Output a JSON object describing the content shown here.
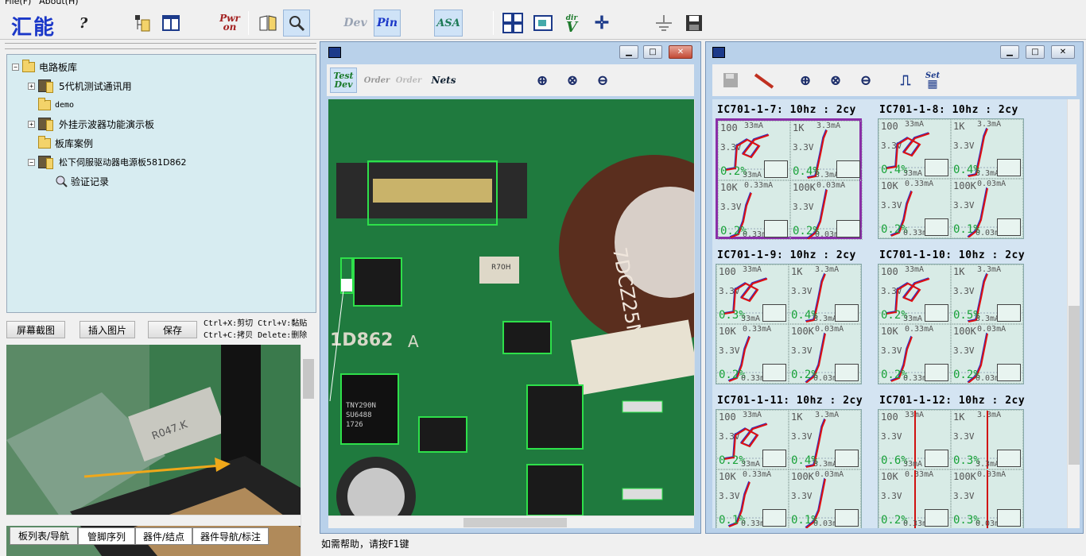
{
  "menu": {
    "items": [
      "File(F)",
      "About(H)"
    ]
  },
  "toolbar": {
    "logo": "汇能",
    "help": "?",
    "pwr_top": "Pwr",
    "pwr_bottom": "on",
    "dev": "Dev",
    "pin": "Pin",
    "asa": "ASA",
    "dirv_top": "dir",
    "dirv_bottom": "V"
  },
  "tree": {
    "root": "电路板库",
    "items": [
      "5代机测试通讯用",
      "demo",
      "外挂示波器功能演示板",
      "板库案例",
      "松下伺服驱动器电源板581D862",
      "验证记录"
    ]
  },
  "left_buttons": {
    "screenshot": "屏幕截图",
    "insert": "插入图片",
    "save": "保存"
  },
  "hints": {
    "line1": "Ctrl+X:剪切 Ctrl+V:黏贴",
    "line2": "Ctrl+C:拷贝 Delete:删除"
  },
  "tabs": [
    "板列表/导航",
    "管脚序列",
    "器件/结点",
    "器件导航/标注"
  ],
  "status": "如需帮助，请按F1键",
  "pcb_window": {
    "tools": {
      "test_top": "Test",
      "test_bottom": "Dev",
      "order1": "Order",
      "order2": "Order",
      "nets": "Nets"
    },
    "board_label": "1D862",
    "board_label2": "A",
    "chip_label": "TNY290N",
    "chip_label2": "SU6488",
    "chip_label3": "1726"
  },
  "curve_window": {
    "tools": {
      "set": "Set"
    },
    "panels": [
      {
        "title": "IC701-1-7: 10hz : 2cy",
        "pct": [
          "0.2%",
          "0.4%",
          "0.2%",
          "0.2%"
        ]
      },
      {
        "title": "IC701-1-8: 10hz : 2cy",
        "pct": [
          "0.4%",
          "0.4%",
          "0.2%",
          "0.1%"
        ]
      },
      {
        "title": "IC701-1-9: 10hz : 2cy",
        "pct": [
          "0.3%",
          "0.4%",
          "0.2%",
          "0.2%"
        ]
      },
      {
        "title": "IC701-1-10: 10hz : 2cy",
        "pct": [
          "0.2%",
          "0.5%",
          "0.2%",
          "0.2%"
        ]
      },
      {
        "title": "IC701-1-11: 10hz : 2cy",
        "pct": [
          "0.2%",
          "0.4%",
          "0.1%",
          "0.1%"
        ]
      },
      {
        "title": "IC701-1-12: 10hz : 2cy",
        "pct": [
          "0.6%",
          "0.3%",
          "0.2%",
          "0.3%"
        ]
      }
    ],
    "ranges": [
      "100",
      "1K",
      "10K",
      "100K"
    ],
    "ma_top": [
      "33mA",
      "3.3mA",
      "0.33mA",
      "0.03mA"
    ],
    "ma_bottom": [
      "33mA",
      "3.3mA",
      "0.33mA",
      "0.03mA"
    ],
    "volt": "3.3V"
  }
}
